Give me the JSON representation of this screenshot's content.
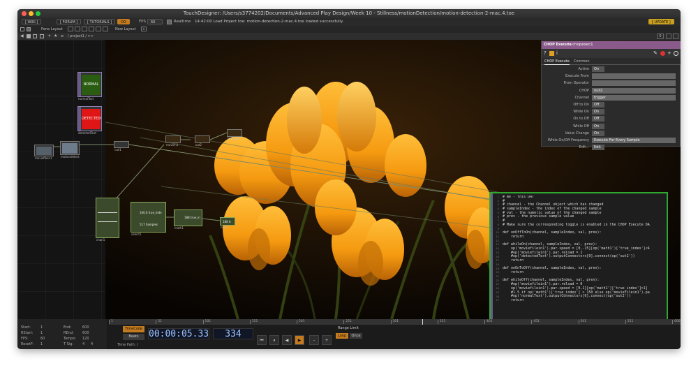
{
  "window": {
    "title": "TouchDesigner: /Users/s3774202/Documents/Advanced Play Design/Week 10 - Stillness/motionDetection/motion-detection-2-mac.4.toe"
  },
  "topbar": {
    "wiki": "[ WIKI ]",
    "forum": "[ FORUM ]",
    "tutorials": "[ TUTORIALS ]",
    "oo": "OO",
    "fps_label": "FPS",
    "fps_value": "60",
    "realtime": "Realtime",
    "status": "14:42:00 Load Project  toe: motion-detection-2-mac.4.toe loaded successfully.",
    "update": "[ UPDATE ]"
  },
  "layoutbar": {
    "pane_layout": "Pane Layout",
    "new_layout": "New Layout",
    "plus": "+"
  },
  "pathbar": {
    "path": "/ project1 / >>",
    "pane_num": "0"
  },
  "nodes": {
    "normal_text": "NORMAL",
    "detected_text": "DETECTED!",
    "normaltext_label": "normalText",
    "detected_label": "detectedText",
    "moviefilein_label": "moviefilein1",
    "motiondetect_label": "motiondetect",
    "null_label": "null1",
    "movein_label": "movein1",
    "out_label": "out2",
    "feedback_label": "feedback",
    "math_label": "math1",
    "select_label": "select1",
    "null2_label": "null2",
    "trueindex_text": "100.0 true_inde",
    "samples_text": "517 Samples",
    "trueinfo_text": "188 true_in",
    "null2_text": "188 tr",
    "chan_label": "chan1"
  },
  "params": {
    "op_type": "CHOP Execute",
    "op_name": "chopexec1",
    "tab_chop_execute": "CHOP Execute",
    "tab_common": "Common",
    "rows": [
      {
        "name": "Active",
        "value": "On"
      },
      {
        "name": "Execute From",
        "value": ""
      },
      {
        "name": "From Operator",
        "value": ""
      },
      {
        "name": "CHOP",
        "value": "null2"
      },
      {
        "name": "Channel",
        "value": "trigger"
      },
      {
        "name": "Off to On",
        "value": "Off"
      },
      {
        "name": "While On",
        "value": "On"
      },
      {
        "name": "On to Off",
        "value": "Off"
      },
      {
        "name": "While Off",
        "value": "On"
      },
      {
        "name": "Value Change",
        "value": "On"
      },
      {
        "name": "While On/Off Frequency",
        "value": "Execute For Every Sample"
      },
      {
        "name": "Edit...",
        "value": "Edit"
      }
    ]
  },
  "dat": {
    "label": "chopexec1",
    "lines": [
      "# me - this DAT",
      "#",
      "# channel - the Channel object which has changed",
      "# sampleIndex - the index of the changed sample",
      "# val - the numeric value of the changed sample",
      "# prev - the previous sample value",
      "#",
      "# Make sure the corresponding toggle is enabled in the CHOP Execute DA",
      "",
      "def onOffToOn(channel, sampleIndex, val, prev):",
      "    return",
      "",
      "def whileOn(channel, sampleIndex, val, prev):",
      "    op('moviefilein1').par.speed = [0,-15][op('math1')['true_index']<4",
      "    #op('moviefilein1').par.reload = 1",
      "    #op('detectedText').outputConnectors[0].connect(op('out2'))",
      "    return",
      "",
      "def onOnToOff(channel, sampleIndex, val, prev):",
      "    return",
      "",
      "def whileOff(channel, sampleIndex, val, prev):",
      "    #op('moviefilein1').par.reload = 0",
      "    op('moviefilein1').par.speed = [0,1][op('math1')['true_index']>1]",
      "    #1.5 if op('math1')['true_index'] > 150 else op('moviefilein1').pa",
      "    #op('normalText').outputConnectors[0].connect(op('out2'))",
      "    return"
    ]
  },
  "timeline": {
    "start_label": "Start:",
    "start_value": "1",
    "end_label": "End:",
    "end_value": "600",
    "rstart_label": "RStart:",
    "rstart_value": "1",
    "rend_label": "REnd:",
    "rend_value": "600",
    "fps_label": "FPS:",
    "fps_value": "60",
    "tempo_label": "Tempo:",
    "tempo_value": "120",
    "resetf_label": "ResetF:",
    "resetf_value": "1",
    "tsig_label": "T Sig:",
    "tsig_a": "4",
    "tsig_b": "4",
    "ruler_ticks": [
      "1",
      "51",
      "101",
      "151",
      "201",
      "251",
      "301",
      "351",
      "401",
      "451",
      "501",
      "551",
      "600"
    ],
    "timecode_label": "TimeCode",
    "beats_label": "Beats",
    "timecode": "00:00:05.33",
    "frame": "334",
    "range_limit": "Range Limit",
    "loop": "Loop",
    "once": "Once",
    "time_path": "Time Path: /",
    "minus": "-",
    "plus": "+"
  }
}
